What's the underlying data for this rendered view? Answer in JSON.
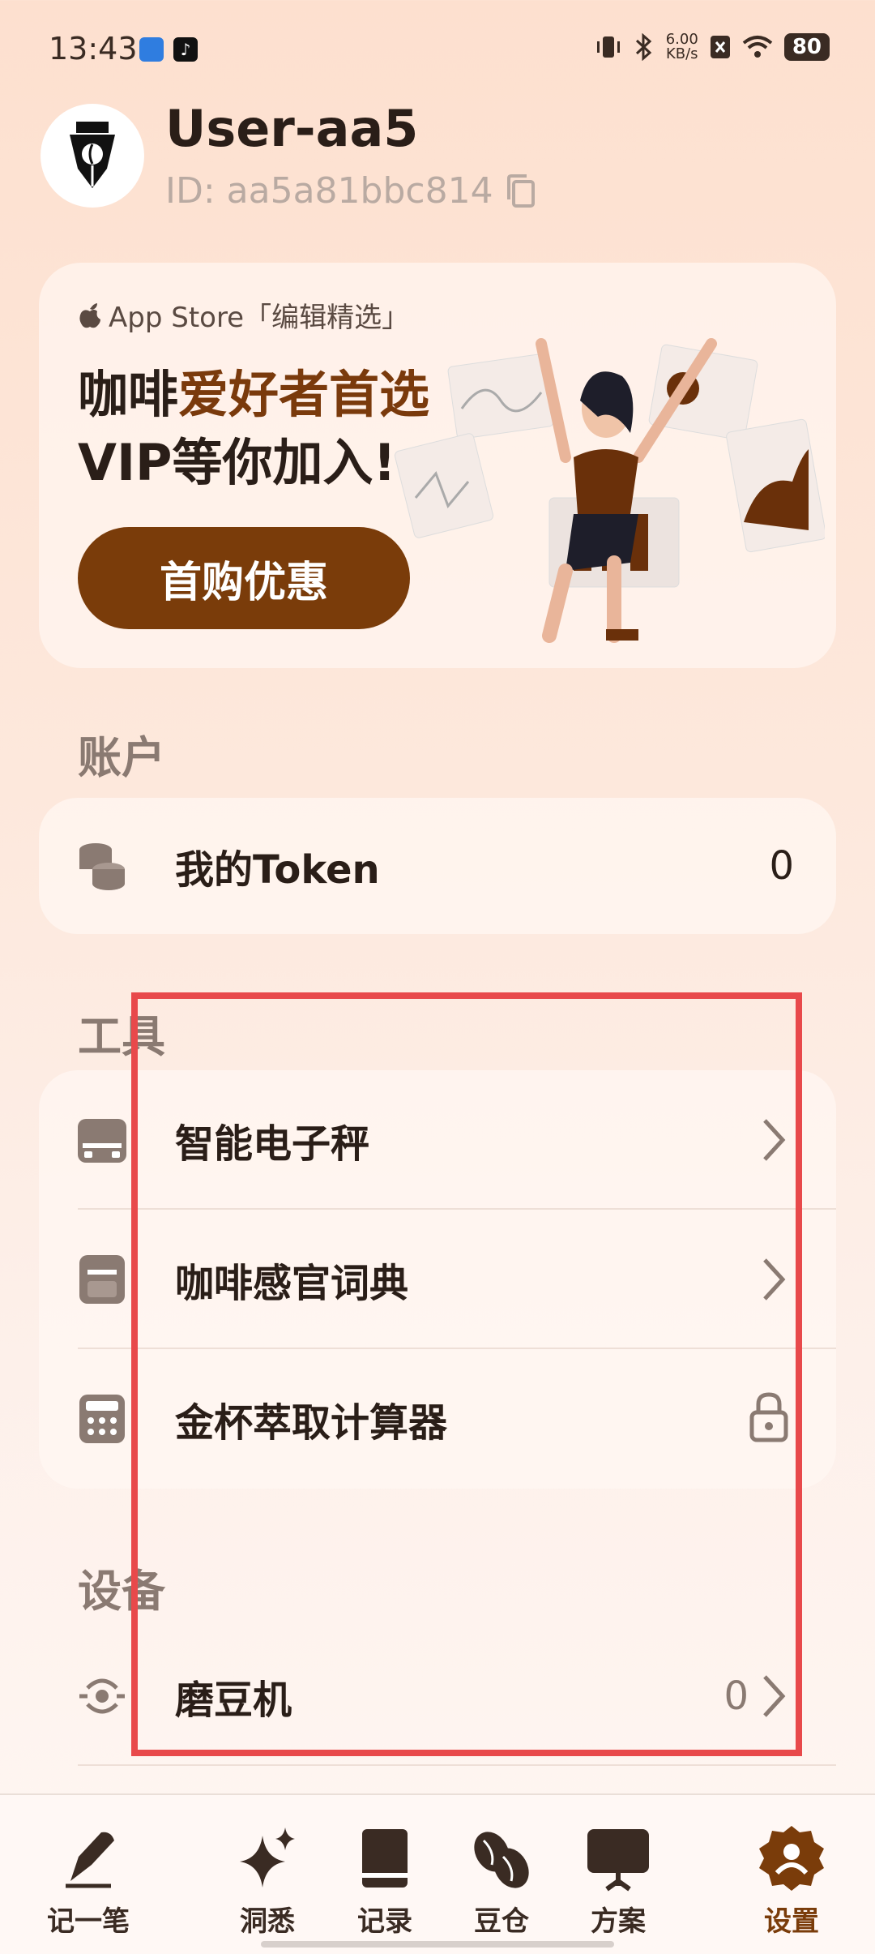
{
  "status": {
    "time": "13:43",
    "speed_value": "6.00",
    "speed_unit": "KB/s",
    "battery": "80"
  },
  "profile": {
    "username": "User-aa5",
    "id_text": "ID: aa5a81bbc814"
  },
  "promo": {
    "store_label": "App Store「编辑精选」",
    "line1_normal": "咖啡",
    "line1_highlight": "爱好者首选",
    "line2": "VIP等你加入!",
    "button": "首购优惠"
  },
  "account": {
    "title": "账户",
    "token_label": "我的Token",
    "token_value": "0"
  },
  "tools": {
    "title": "工具",
    "items": [
      {
        "label": "智能电子秤"
      },
      {
        "label": "咖啡感官词典"
      },
      {
        "label": "金杯萃取计算器"
      }
    ]
  },
  "devices": {
    "title": "设备",
    "grinder_label": "磨豆机",
    "grinder_count": "0"
  },
  "nav": {
    "items": [
      {
        "label": "记一笔"
      },
      {
        "label": "洞悉"
      },
      {
        "label": "记录"
      },
      {
        "label": "豆仓"
      },
      {
        "label": "方案"
      },
      {
        "label": "设置"
      }
    ]
  },
  "colors": {
    "accent": "#7a3c0a",
    "highlight_border": "#e8494b"
  }
}
